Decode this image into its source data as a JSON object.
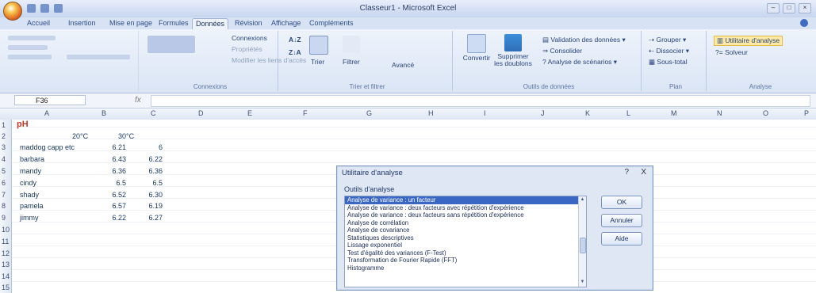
{
  "window": {
    "title": "Classeur1 - Microsoft Excel"
  },
  "tabs": [
    "Accueil",
    "Insertion",
    "Mise en page",
    "Formules",
    "Données",
    "Révision",
    "Affichage",
    "Compléments"
  ],
  "active_tab": "Données",
  "ribbon": {
    "connexions_label": "Connexions",
    "proprietes_label": "Propriétés",
    "modifier_liens_label": "Modifier les liens d'accès",
    "sort_label": "Trier",
    "filter_label": "Filtrer",
    "advanced_label": "Avancé",
    "text_to_columns_label": "Convertir",
    "remove_duplicates_label": "Supprimer les doublons",
    "data_validation_label": "Validation des données",
    "consolidate_label": "Consolider",
    "what_if_label": "Analyse de scénarios",
    "group_label": "Grouper",
    "ungroup_label": "Dissocier",
    "subtotal_label": "Sous-total",
    "data_analysis_label": "Utilitaire d'analyse",
    "solver_label": "Solveur",
    "group_connexions": "Connexions",
    "group_sort": "Trier et filtrer",
    "group_tools": "Outils de données",
    "group_plan": "Plan",
    "group_analysis": "Analyse"
  },
  "formula_bar": {
    "name_box": "F36",
    "fx": "fx"
  },
  "columns": [
    "A",
    "B",
    "C",
    "D",
    "E",
    "F",
    "G",
    "H",
    "I",
    "J",
    "K",
    "L",
    "M",
    "N",
    "O",
    "P"
  ],
  "rows": [
    "1",
    "2",
    "3",
    "4",
    "5",
    "6",
    "7",
    "8",
    "9",
    "10",
    "11",
    "12",
    "13",
    "14",
    "15"
  ],
  "sheet": {
    "title": "pH",
    "col_b_header": "20°C",
    "col_c_header": "30°C",
    "data": [
      {
        "name": "maddog capp etc",
        "b": "6.21",
        "c": "6"
      },
      {
        "name": "barbara",
        "b": "6.43",
        "c": "6.22"
      },
      {
        "name": "mandy",
        "b": "6.36",
        "c": "6.36"
      },
      {
        "name": "cindy",
        "b": "6.5",
        "c": "6.5"
      },
      {
        "name": "shady",
        "b": "6.52",
        "c": "6.30"
      },
      {
        "name": "pamela",
        "b": "6.57",
        "c": "6.19"
      },
      {
        "name": "jimmy",
        "b": "6.22",
        "c": "6.27"
      }
    ]
  },
  "dialog": {
    "title": "Utilitaire d'analyse",
    "list_label": "Outils d'analyse",
    "items": [
      "Analyse de variance : un facteur",
      "Analyse de variance : deux facteurs avec répétition d'expérience",
      "Analyse de variance : deux facteurs sans répétition d'expérience",
      "Analyse de corrélation",
      "Analyse de covariance",
      "Statistiques descriptives",
      "Lissage exponentiel",
      "Test d'égalité des variances (F-Test)",
      "Transformation de Fourier Rapide (FFT)",
      "Histogramme"
    ],
    "selected_index": 0,
    "ok_label": "OK",
    "cancel_label": "Annuler",
    "help_label": "Aide",
    "help_glyph": "?",
    "close_glyph": "X"
  }
}
